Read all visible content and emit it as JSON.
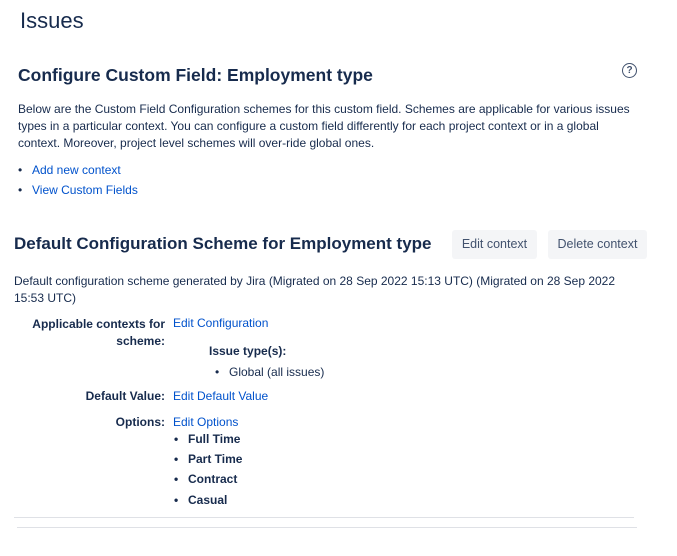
{
  "page_title": "Issues",
  "heading": "Configure Custom Field: Employment type",
  "help_icon": "?",
  "description": "Below are the Custom Field Configuration schemes for this custom field. Schemes are applicable for various issues types in a particular context. You can configure a custom field differently for each project context or in a global context. Moreover, project level schemes will over-ride global ones.",
  "links": [
    "Add new context",
    "View Custom Fields"
  ],
  "scheme": {
    "title": "Default Configuration Scheme for Employment type",
    "edit_context": "Edit context",
    "delete_context": "Delete context",
    "description": "Default configuration scheme generated by Jira (Migrated on 28 Sep 2022 15:13 UTC) (Migrated on 28 Sep 2022 15:53 UTC)",
    "contexts_label": "Applicable contexts for scheme:",
    "edit_configuration": "Edit Configuration",
    "issue_types_label": "Issue type(s):",
    "issue_types": [
      "Global (all issues)"
    ],
    "default_value_label": "Default Value:",
    "edit_default_value": "Edit Default Value",
    "options_label": "Options:",
    "edit_options": "Edit Options",
    "options": [
      "Full Time",
      "Part Time",
      "Contract",
      "Casual"
    ]
  }
}
